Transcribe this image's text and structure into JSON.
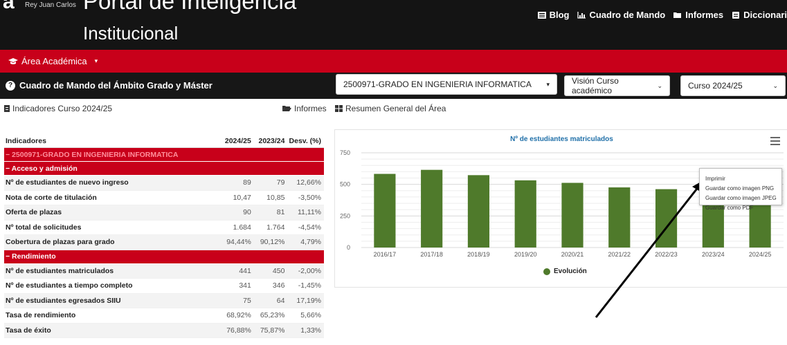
{
  "header": {
    "logo_letter": "a",
    "university": "Rey Juan Carlos",
    "title_line1": "Portal de Inteligencia",
    "title_line2": "Institucional",
    "nav": [
      {
        "label": "Blog",
        "icon": "newspaper-icon"
      },
      {
        "label": "Cuadro de Mando",
        "icon": "chart-icon"
      },
      {
        "label": "Informes",
        "icon": "folder-icon"
      },
      {
        "label": "Diccionari",
        "icon": "book-icon"
      }
    ]
  },
  "area_menu": {
    "label": "Área Académica",
    "icon": "graduation-cap-icon"
  },
  "dashboard": {
    "title": "Cuadro de Mando del Ámbito Grado y Máster",
    "degree_select": "2500971-GRADO EN INGENIERIA INFORMATICA",
    "vision_select": "Visión Curso académico",
    "course_select": "Curso 2024/25"
  },
  "subheader": {
    "indicators_label": "Indicadores Curso 2024/25",
    "reports_label": "Informes",
    "summary_label": "Resumen General del Área"
  },
  "table": {
    "headers": [
      "Indicadores",
      "2024/25",
      "2023/24",
      "Desv. (%)"
    ],
    "degree_row": "− 2500971-GRADO EN INGENIERIA INFORMATICA",
    "sections": [
      {
        "title": "− Acceso y admisión",
        "rows": [
          {
            "name": "Nº de estudiantes de nuevo ingreso",
            "v1": "89",
            "v2": "79",
            "dev": "12,66%"
          },
          {
            "name": "Nota de corte de titulación",
            "v1": "10,47",
            "v2": "10,85",
            "dev": "-3,50%"
          },
          {
            "name": "Oferta de plazas",
            "v1": "90",
            "v2": "81",
            "dev": "11,11%"
          },
          {
            "name": "Nº total de solicitudes",
            "v1": "1.684",
            "v2": "1.764",
            "dev": "-4,54%"
          },
          {
            "name": "Cobertura de plazas para grado",
            "v1": "94,44%",
            "v2": "90,12%",
            "dev": "4,79%"
          }
        ]
      },
      {
        "title": "− Rendimiento",
        "rows": [
          {
            "name": "Nº de estudiantes matriculados",
            "v1": "441",
            "v2": "450",
            "dev": "-2,00%"
          },
          {
            "name": "Nº de estudiantes a tiempo completo",
            "v1": "341",
            "v2": "346",
            "dev": "-1,45%"
          },
          {
            "name": "Nº de estudiantes egresados SIIU",
            "v1": "75",
            "v2": "64",
            "dev": "17,19%"
          },
          {
            "name": "Tasa de rendimiento",
            "v1": "68,92%",
            "v2": "65,23%",
            "dev": "5,66%"
          },
          {
            "name": "Tasa de éxito",
            "v1": "76,88%",
            "v2": "75,87%",
            "dev": "1,33%"
          }
        ]
      }
    ]
  },
  "export_menu": {
    "items": [
      "Imprimir",
      "Guardar como imagen PNG",
      "Guardar como imagen JPEG",
      "Guardar como PDF"
    ]
  },
  "chart_data": {
    "type": "bar",
    "title": "Nº de estudiantes matriculados",
    "categories": [
      "2016/17",
      "2017/18",
      "2018/19",
      "2019/20",
      "2020/21",
      "2021/22",
      "2022/23",
      "2023/24",
      "2024/25"
    ],
    "series": [
      {
        "name": "Evolución",
        "values": [
          583,
          615,
          573,
          532,
          512,
          476,
          462,
          450,
          441
        ]
      }
    ],
    "ylim": [
      0,
      750
    ],
    "yticks": [
      0,
      250,
      500,
      750
    ],
    "grid": true,
    "legend": "bottom-center",
    "bar_color": "#4f7a2b"
  },
  "colors": {
    "accent_red": "#c8001a",
    "dark_bar": "#171717",
    "title_blue": "#1f6fa8"
  }
}
